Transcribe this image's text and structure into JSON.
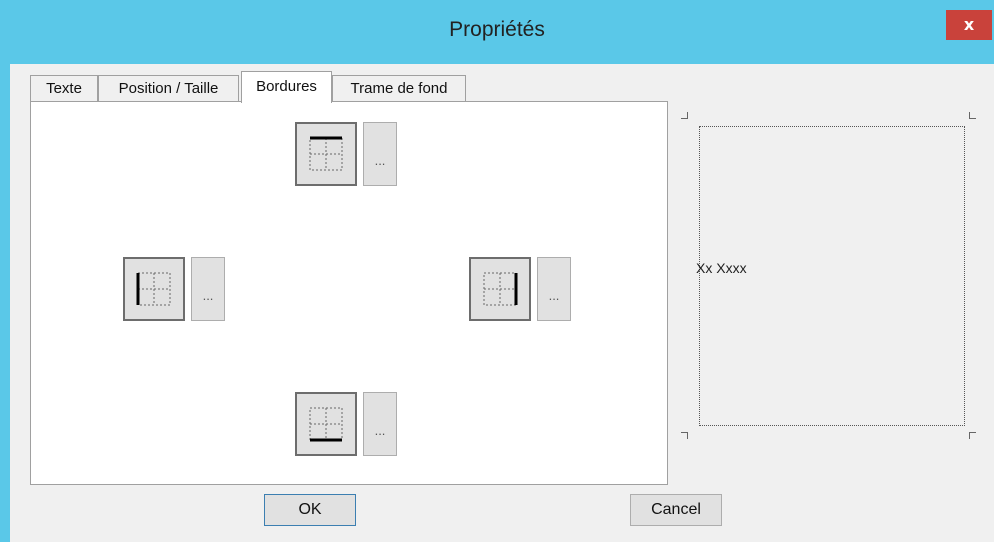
{
  "window": {
    "title": "Propriétés",
    "close_label": "x"
  },
  "tabs": [
    {
      "label": "Texte",
      "active": false
    },
    {
      "label": "Position / Taille",
      "active": false
    },
    {
      "label": "Bordures",
      "active": true
    },
    {
      "label": "Trame de fond",
      "active": false
    }
  ],
  "borders": {
    "top": {
      "icon": "border-top-icon",
      "more_label": "..."
    },
    "left": {
      "icon": "border-left-icon",
      "more_label": "..."
    },
    "right": {
      "icon": "border-right-icon",
      "more_label": "..."
    },
    "bottom": {
      "icon": "border-bottom-icon",
      "more_label": "..."
    }
  },
  "preview": {
    "text": "Xx Xxxx"
  },
  "buttons": {
    "ok": "OK",
    "cancel": "Cancel"
  },
  "colors": {
    "titlebar": "#5ac8e8",
    "close": "#c9423b",
    "ok_border": "#3c7fb1"
  }
}
